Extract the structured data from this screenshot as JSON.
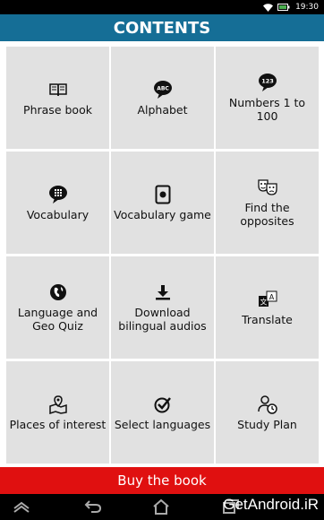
{
  "status_bar": {
    "time": "19:30",
    "icons": [
      "wifi-icon",
      "battery-icon"
    ]
  },
  "header": {
    "title": "CONTENTS"
  },
  "tiles": [
    {
      "label": "Phrase book",
      "icon": "book-icon"
    },
    {
      "label": "Alphabet",
      "icon": "abc-bubble-icon",
      "icon_text": "ABC"
    },
    {
      "label": "Numbers 1 to 100",
      "icon": "123-bubble-icon",
      "icon_text": "123"
    },
    {
      "label": "Vocabulary",
      "icon": "grid-bubble-icon"
    },
    {
      "label": "Vocabulary game",
      "icon": "card-game-icon"
    },
    {
      "label": "Find the opposites",
      "icon": "theater-masks-icon"
    },
    {
      "label": "Language and Geo Quiz",
      "icon": "globe-icon"
    },
    {
      "label": "Download bilingual audios",
      "icon": "download-icon"
    },
    {
      "label": "Translate",
      "icon": "translate-icon"
    },
    {
      "label": "Places of interest",
      "icon": "map-pin-icon"
    },
    {
      "label": "Select languages",
      "icon": "check-circle-icon"
    },
    {
      "label": "Study Plan",
      "icon": "study-plan-icon"
    }
  ],
  "buy_button": {
    "label": "Buy the book"
  },
  "nav_bar": {
    "buttons": [
      "menu-up-icon",
      "back-icon",
      "home-icon",
      "recents-icon"
    ]
  },
  "watermark": {
    "text": "GetAndroid.iR"
  },
  "colors": {
    "header_bg": "#156e96",
    "tile_bg": "#e1e1e1",
    "buy_bg": "#e01010"
  }
}
